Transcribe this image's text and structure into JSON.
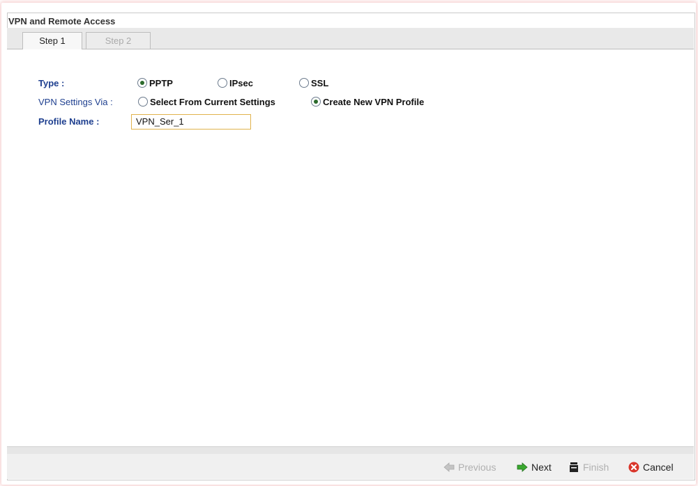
{
  "window": {
    "title": "VPN and Remote Access"
  },
  "tabs": [
    {
      "label": "Step 1",
      "active": true
    },
    {
      "label": "Step 2",
      "active": false
    }
  ],
  "form": {
    "type_label": "Type :",
    "type_options": [
      {
        "label": "PPTP",
        "selected": true
      },
      {
        "label": "IPsec",
        "selected": false
      },
      {
        "label": "SSL",
        "selected": false
      }
    ],
    "settings_label": "VPN Settings Via :",
    "settings_options": [
      {
        "label": "Select From Current Settings",
        "selected": false
      },
      {
        "label": "Create New VPN Profile",
        "selected": true
      }
    ],
    "profile_label": "Profile Name :",
    "profile_value": "VPN_Ser_1"
  },
  "buttons": {
    "previous": "Previous",
    "next": "Next",
    "finish": "Finish",
    "cancel": "Cancel"
  },
  "colors": {
    "label_blue": "#1e3f8f",
    "input_border": "#e0b24c",
    "cancel_red": "#d9362b",
    "next_green": "#3aa82f"
  },
  "icons": {
    "previous": "arrow-left-icon",
    "next": "arrow-right-icon",
    "finish": "finish-flag-icon",
    "cancel": "cancel-circle-icon"
  }
}
